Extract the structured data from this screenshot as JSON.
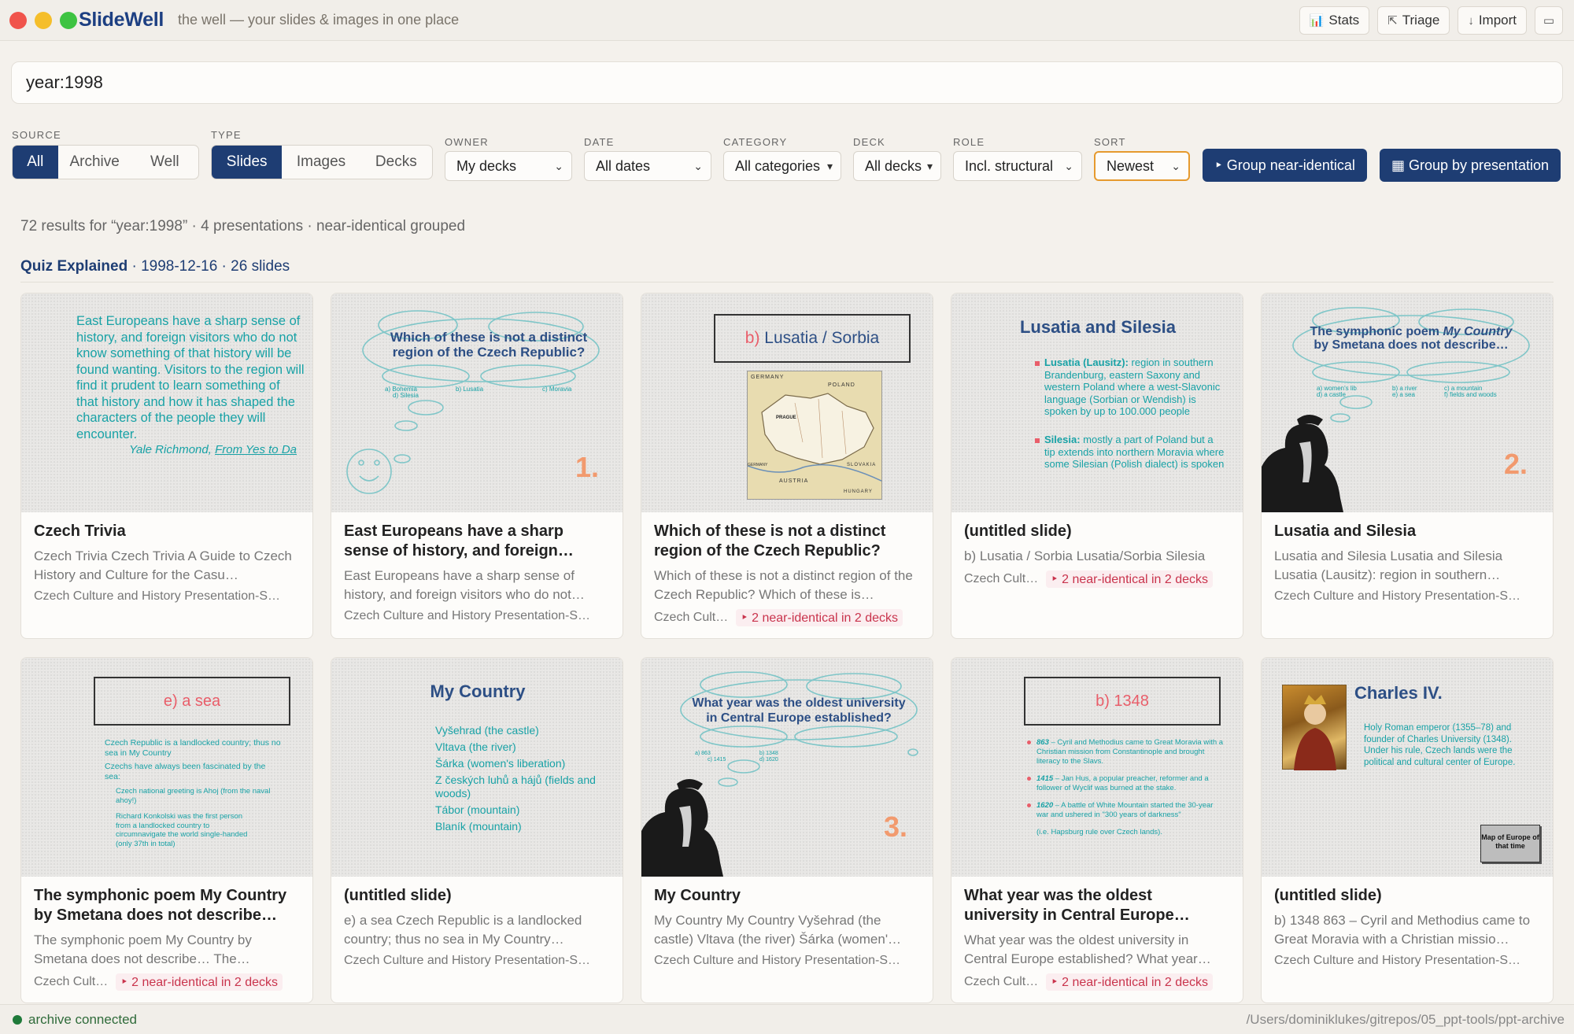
{
  "app": {
    "name": "SlideWell",
    "tagline": "the well — your slides & images in one place",
    "actions": [
      {
        "icon": "📊",
        "label": "Stats"
      },
      {
        "icon": "⇱",
        "label": "Triage"
      },
      {
        "icon": "↓",
        "label": "Import"
      },
      {
        "icon": "▭",
        "label": ""
      }
    ]
  },
  "search": {
    "value": "year:1998"
  },
  "filters": {
    "source": {
      "label": "SOURCE",
      "options": [
        "All",
        "Archive",
        "Well"
      ],
      "selected": "All"
    },
    "type": {
      "label": "TYPE",
      "options": [
        "Slides",
        "Images",
        "Decks"
      ],
      "selected": "Slides"
    },
    "owner": {
      "label": "OWNER",
      "value": "My decks"
    },
    "date": {
      "label": "DATE",
      "value": "All dates"
    },
    "category": {
      "label": "CATEGORY",
      "value": "All categories"
    },
    "deck": {
      "label": "DECK",
      "value": "All decks"
    },
    "role": {
      "label": "ROLE",
      "value": "Incl. structural"
    },
    "sort": {
      "label": "SORT",
      "value": "Newest"
    },
    "group_near_identical": "‣ Group near-identical",
    "group_by_presentation": "▦ Group by presentation"
  },
  "summary": "72 results for “year:1998” · 4 presentations · near-identical grouped",
  "group": {
    "name": "Quiz Explained",
    "info": "· 1998-12-16 · 26 slides"
  },
  "cards": [
    {
      "title": "Czech Trivia",
      "desc": "Czech Trivia Czech Trivia A Guide to Czech History and Culture for the Casu…",
      "meta": "Czech Culture and History Presentation-S…",
      "badge": ""
    },
    {
      "title": "East Europeans have a sharp sense of history, and foreign…",
      "desc": "East Europeans have a sharp sense of history, and foreign visitors who do not…",
      "meta": "Czech Culture and History Presentation-S…",
      "badge": ""
    },
    {
      "title": "Which of these is not a distinct region of the Czech Republic?",
      "desc": "Which of these is not a distinct region of the Czech Republic? Which of these is…",
      "meta": "Czech Cult…",
      "badge": "‣ 2 near-identical in 2 decks"
    },
    {
      "title": "(untitled slide)",
      "desc": "b) Lusatia / Sorbia Lusatia/Sorbia Silesia",
      "meta": "Czech Cult…",
      "badge": "‣ 2 near-identical in 2 decks"
    },
    {
      "title": "Lusatia and Silesia",
      "desc": "Lusatia and Silesia Lusatia and Silesia Lusatia (Lausitz): region in southern…",
      "meta": "Czech Culture and History Presentation-S…",
      "badge": ""
    },
    {
      "title": "The symphonic poem My Country by Smetana does not describe…",
      "desc": "The symphonic poem My Country by Smetana does not describe… The…",
      "meta": "Czech Cult…",
      "badge": "‣ 2 near-identical in 2 decks"
    },
    {
      "title": "(untitled slide)",
      "desc": "e) a sea Czech Republic is a landlocked country; thus no sea in My Country…",
      "meta": "Czech Culture and History Presentation-S…",
      "badge": ""
    },
    {
      "title": "My Country",
      "desc": "My Country My Country Vyšehrad (the castle) Vltava (the river) Šárka (women'…",
      "meta": "Czech Culture and History Presentation-S…",
      "badge": ""
    },
    {
      "title": "What year was the oldest university in Central Europe…",
      "desc": "What year was the oldest university in Central Europe established? What year…",
      "meta": "Czech Cult…",
      "badge": "‣ 2 near-identical in 2 decks"
    },
    {
      "title": "(untitled slide)",
      "desc": "b) 1348 863 – Cyril and Methodius came to Great Moravia with a Christian missio…",
      "meta": "Czech Culture and History Presentation-S…",
      "badge": ""
    }
  ],
  "slides": {
    "s1": {
      "quote": "East Europeans have a sharp sense of history, and foreign visitors who do not know something of that history will be found wanting. Visitors to the region will find it prudent to learn something of that history and how it has shaped the characters of the people they will encounter.",
      "author": "Yale Richmond,",
      "source": "From Yes to Da"
    },
    "s2": {
      "question": "Which of these is not a distinct region of the Czech Republic?",
      "a": "a) Bohemia",
      "b": "b) Lusatia",
      "c": "c) Moravia",
      "d": "d) Silesia",
      "num": "1."
    },
    "s3": {
      "answer_letter": "b)",
      "answer": "Lusatia / Sorbia",
      "map": {
        "germany": "GERMANY",
        "poland": "POLAND",
        "austria": "AUSTRIA",
        "slovakia": "SLOVAKIA",
        "hungary": "HUNGARY",
        "prague": "PRAGUE",
        "germany2": "GERMANY"
      }
    },
    "s4": {
      "title": "Lusatia and Silesia",
      "b1_bold": "Lusatia (Lausitz):",
      "b1": "region in southern Brandenburg, eastern Saxony and western Poland where a west-Slavonic language (Sorbian or Wendish) is spoken by up to 100.000 people",
      "b2_bold": "Silesia:",
      "b2": "mostly a part of Poland but a tip extends into northern Moravia where some Silesian (Polish dialect) is spoken"
    },
    "s5": {
      "question": "The symphonic poem",
      "q_italic": "My Country",
      "q_end": "by Smetana does not describe…",
      "a": "a) women's lib",
      "b": "b) a river",
      "c": "c) a mountain",
      "d": "d) a castle",
      "e": "e) a sea",
      "f": "f) fields and woods",
      "num": "2."
    },
    "s6": {
      "answer": "e) a sea",
      "l1": "Czech Republic is a landlocked country; thus no sea in My Country",
      "l2": "Czechs have always been fascinated by the sea:",
      "l3": "Czech national greeting is Ahoj (from the naval ahoy!)",
      "l4": "Richard Konkolski was the first person from a landlocked country to circumnavigate the world single-handed (only 37th in total)"
    },
    "s7": {
      "title": "My Country",
      "items": [
        "Vyšehrad (the castle)",
        "Vltava (the river)",
        "Šárka (women's liberation)",
        "Z českých luhů a hájů (fields and woods)",
        "Tábor (mountain)",
        "Blaník (mountain)"
      ]
    },
    "s8": {
      "question": "What year was the oldest university in Central Europe established?",
      "a": "a) 863",
      "b": "b) 1348",
      "c": "c) 1415",
      "d": "d) 1620",
      "num": "3."
    },
    "s9": {
      "answer": "b) 1348",
      "e1y": "863",
      "e1": "– Cyril and Methodius came to Great Moravia with a Christian mission from Constantinople and brought literacy to the Slavs.",
      "e2y": "1415",
      "e2": "– Jan Hus, a popular preacher, reformer and a follower of Wyclif was burned at the stake.",
      "e3y": "1620",
      "e3": "– A battle of White Mountain started the 30-year war and ushered in \"300 years of darkness\"",
      "e4": "(i.e. Hapsburg rule over Czech lands)."
    },
    "s10": {
      "title": "Charles IV.",
      "text": "Holy Roman emperor (1355–78) and founder of Charles University (1348). Under his rule, Czech lands were the political and cultural center of Europe.",
      "map_label": "Map of Europe of that time"
    }
  },
  "status": {
    "connection": "archive connected",
    "path": "/Users/dominiklukes/gitrepos/05_ppt-tools/ppt-archive"
  },
  "colors": {
    "brand": "#1e3d73",
    "accent_sort": "#e69a2e",
    "badge": "#c9334c",
    "slide_teal": "#18a2a6",
    "slide_title": "#2d4f85",
    "slide_num": "#f29a6e"
  }
}
